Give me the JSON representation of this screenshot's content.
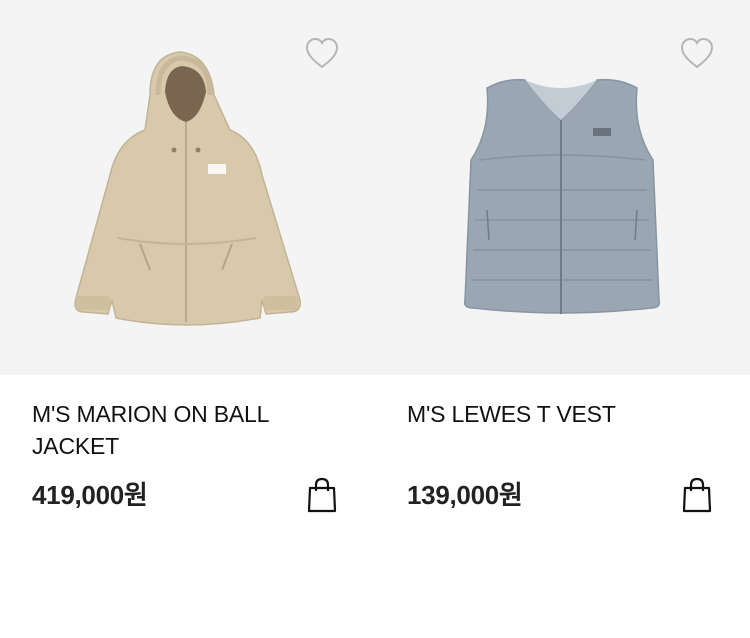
{
  "products": [
    {
      "name": "M'S MARION ON BALL JACKET",
      "price": "419,000원",
      "image_icon": "beige-hooded-jacket-image",
      "image_color": "#d8c9ad",
      "wishlist_icon": "heart-outline-icon",
      "cart_icon": "shopping-bag-icon"
    },
    {
      "name": "M'S LEWES T VEST",
      "price": "139,000원",
      "image_icon": "grey-down-vest-image",
      "image_color": "#9aa6b3",
      "wishlist_icon": "heart-outline-icon",
      "cart_icon": "shopping-bag-icon"
    }
  ]
}
